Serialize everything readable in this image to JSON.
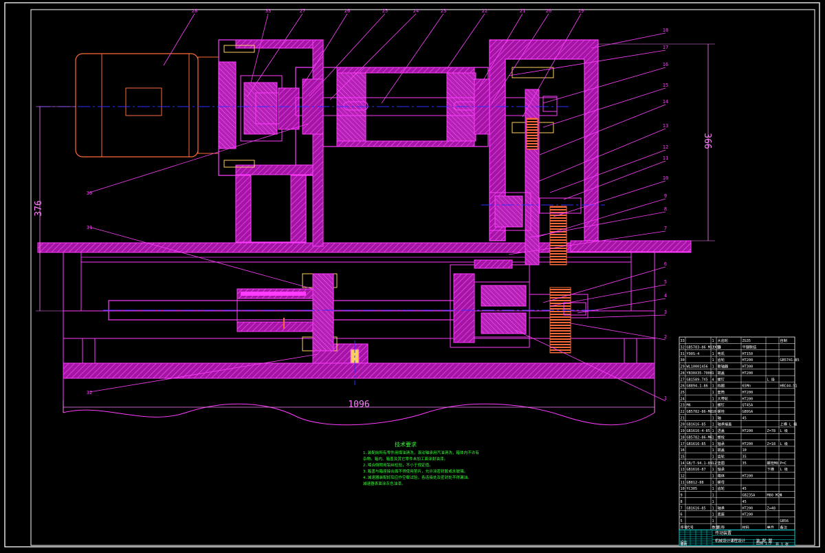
{
  "colors": {
    "background": "#000000",
    "frame": "#ffffff",
    "part_outline": "#ff3cff",
    "part_fill": "#b018b0",
    "hatch": "#e040e0",
    "centerline": "#3030ff",
    "leader": "#ff40ff",
    "dimension": "#ff80ff",
    "motor": "#ff6a3a",
    "notes": "#33ff33",
    "table_grid": "#00e5e5",
    "highlight": "#ffd060"
  },
  "dimensions": {
    "overall_length": "1096",
    "height_left": "376",
    "height_right": "366"
  },
  "balloons": {
    "top": [
      "28",
      "33",
      "27",
      "26",
      "25",
      "24",
      "23",
      "22",
      "21",
      "20",
      "19"
    ],
    "right": [
      "18",
      "17",
      "16",
      "15",
      "14",
      "13",
      "12",
      "11",
      "10",
      "9",
      "8",
      "7",
      "6",
      "5",
      "4",
      "3",
      "2",
      "1"
    ],
    "left": [
      "30",
      "31",
      "32"
    ]
  },
  "notes": {
    "title": "技术要求",
    "lines": [
      "1.装配前所有零件用煤油清洗，滚动轴承用汽油清洗，箱体内不许有",
      "  杂物。箱内、箱盖及其它零件未加工面涂耐油漆。",
      "2.啮合侧隙用铅丝检验，不小于规定值。",
      "3.箱盖与箱座接合面不得使用垫片，允许涂密封胶或水玻璃。",
      "4.减速器装配好后应作空载试验，各连接处及密封处不得漏油。",
      "  减速器表面涂灰色油漆。"
    ]
  },
  "parts_table": {
    "rows": [
      [
        "33",
        "",
        "1",
        "大齿轮",
        "ZG35",
        "",
        "自制"
      ],
      [
        "32",
        "GB5783-86 M12X35",
        "1",
        "键",
        "平键联结",
        "",
        ""
      ],
      [
        "31",
        "Y90S-4",
        "1",
        "电机",
        "HT150",
        "",
        ""
      ],
      [
        "30",
        "",
        "1",
        "齿轮",
        "HT200",
        "",
        "GB5741-85"
      ],
      [
        "29",
        "WL10001456",
        "1",
        "联轴器",
        "HT300",
        "",
        ""
      ],
      [
        "28",
        "YB30X35-7000",
        "1",
        "端盖",
        "HT200",
        "",
        ""
      ],
      [
        "27",
        "GB1589-7X5",
        "4",
        "螺钉",
        "",
        "L 级",
        ""
      ],
      [
        "26",
        "GB894.1-86",
        "1",
        "挡圈",
        "65Mn",
        "",
        "HRC44-51"
      ],
      [
        "25",
        "",
        "1",
        "套筒",
        "HT200",
        "",
        ""
      ],
      [
        "24",
        "",
        "1",
        "大带轮",
        "HT200",
        "",
        ""
      ],
      [
        "23",
        "M6",
        "1",
        "螺钉",
        "QT45A",
        "",
        ""
      ],
      [
        "22",
        "GB5782-86-M8",
        "10",
        "螺栓",
        "GB9SA",
        "",
        ""
      ],
      [
        "21",
        "",
        "1",
        "轴",
        "45",
        "",
        ""
      ],
      [
        "20",
        "GB1616-85",
        "1",
        "轴承端盖",
        "",
        "",
        "上横 L 级"
      ],
      [
        "19",
        "GB1616-4-85",
        "1",
        "透盖",
        "HT200",
        "Z=78",
        "L 级"
      ],
      [
        "18",
        "GB5782-86-M6",
        "1",
        "螺栓",
        "",
        "",
        ""
      ],
      [
        "17",
        "GB1616-85",
        "1",
        "轴承",
        "HT200",
        "Z=18",
        "L 级"
      ],
      [
        "16",
        "",
        "1",
        "端盖",
        "10",
        "",
        ""
      ],
      [
        "15",
        "",
        "1",
        "齿轮",
        "35",
        "",
        ""
      ],
      [
        "14",
        "GB/T-94.1-89.2",
        "1",
        "垫圈",
        "35",
        "螺栓M8",
        "P=C"
      ],
      [
        "13",
        "GB1616-87",
        "1",
        "轴承",
        "",
        "下横",
        "L 级"
      ],
      [
        "12",
        "",
        "1",
        "箱体",
        "HT200",
        "",
        ""
      ],
      [
        "11",
        "GB812-88",
        "1",
        "螺母",
        "",
        "",
        ""
      ],
      [
        "10",
        "YC305",
        "1",
        "齿轮",
        "45",
        "",
        ""
      ],
      [
        "9",
        "",
        "1",
        "",
        "GB235A",
        "M80 M20",
        "6"
      ],
      [
        "8",
        "",
        "1",
        "",
        "45",
        "",
        ""
      ],
      [
        "7",
        "GB1616-85",
        "1",
        "轴承",
        "HT200",
        "Z=48",
        ""
      ],
      [
        "6",
        "",
        "1",
        "底座",
        "HT200",
        "",
        ""
      ],
      [
        "5",
        "",
        "1",
        "",
        "",
        "",
        "GB56"
      ]
    ],
    "header": [
      "序号",
      "代号",
      "数量",
      "名称",
      "材料",
      "单件",
      "备注"
    ],
    "title_block": {
      "drawing_name": "传动装置",
      "designer_row": [
        "设计",
        "",
        "",
        "",
        "",
        "比例",
        "1:5"
      ],
      "check_row": [
        "审核",
        "",
        "",
        "",
        "",
        "共 1 张",
        "第 1 张"
      ],
      "school": "机械设计课程设计",
      "sheet": "装 配 图"
    }
  }
}
